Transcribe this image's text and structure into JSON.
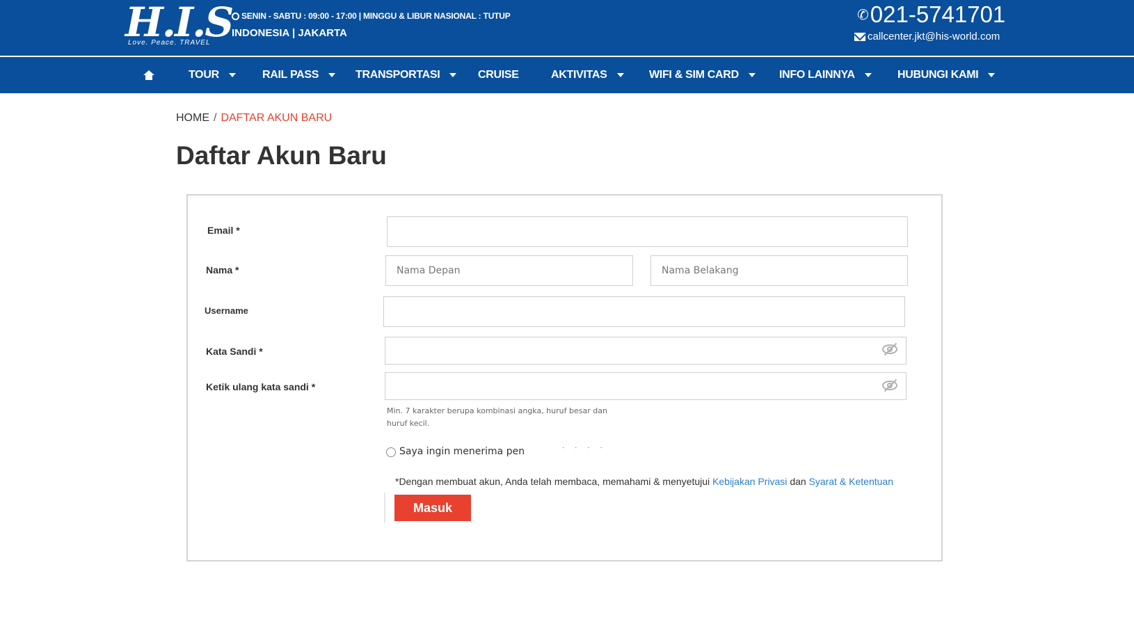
{
  "header": {
    "logo_text": "H.I.S",
    "logo_tagline": "Love. Peace. TRAVEL",
    "hours": "SENIN - SABTU : 09:00 - 17:00 | MINGGU & LIBUR NASIONAL : TUTUP",
    "location": "INDONESIA | JAKARTA",
    "phone": "021-5741701",
    "email": "callcenter.jkt@his-world.com"
  },
  "nav": {
    "items": [
      {
        "label": "TOUR",
        "has_dropdown": true
      },
      {
        "label": "RAIL PASS",
        "has_dropdown": true
      },
      {
        "label": "TRANSPORTASI",
        "has_dropdown": true
      },
      {
        "label": "CRUISE",
        "has_dropdown": false
      },
      {
        "label": "AKTIVITAS",
        "has_dropdown": true
      },
      {
        "label": "WIFI & SIM CARD",
        "has_dropdown": true
      },
      {
        "label": "INFO LAINNYA",
        "has_dropdown": true
      },
      {
        "label": "HUBUNGI KAMI",
        "has_dropdown": true
      }
    ]
  },
  "breadcrumb": {
    "home": "HOME",
    "separator": "/",
    "current": "DAFTAR AKUN BARU"
  },
  "page_title": "Daftar Akun Baru",
  "form": {
    "email_label": "Email *",
    "email_value": "",
    "nama_label": "Nama *",
    "first_name_placeholder": "Nama Depan",
    "last_name_placeholder": "Nama Belakang",
    "username_label": "Username",
    "username_value": "",
    "password_label": "Kata Sandi *",
    "password_value": "",
    "confirm_label": "Ketik ulang kata sandi *",
    "confirm_value": "",
    "password_hint": "Min. 7 karakter berupa kombinasi angka, huruf besar dan huruf kecil.",
    "newsletter_label": "Saya ingin menerima pen",
    "newsletter_trailing": "· · · ·",
    "newsletter_checked": false,
    "terms_prefix": "*Dengan membuat akun, Anda telah membaca, memahami & menyetujui",
    "terms_privacy": "Kebijakan Privasi",
    "terms_and": "dan",
    "terms_conditions": "Syarat & Ketentuan",
    "submit_label": "Masuk"
  },
  "colors": {
    "brand_blue": "#0a4f9c",
    "accent_red": "#e8412f",
    "link_blue": "#2a7fc9"
  }
}
